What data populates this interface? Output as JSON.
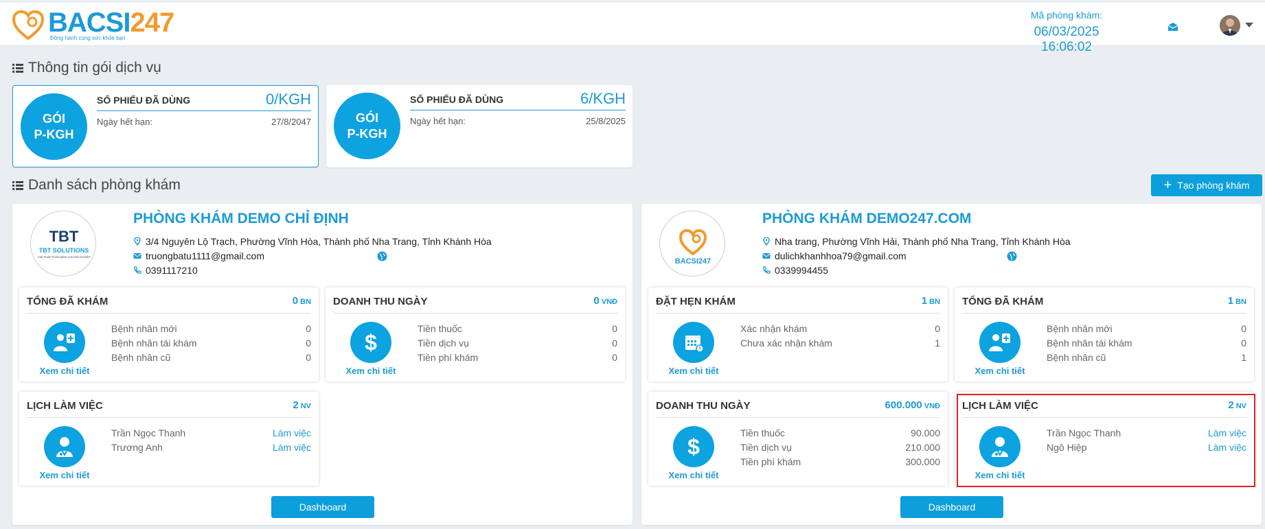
{
  "header": {
    "logo_text": "BACSI247",
    "logo_tagline": "Đồng hành cùng sức khỏe bạn",
    "clinic_code_label": "Mã phòng khám:",
    "datetime": "06/03/2025 16:06:02",
    "icons": [
      "heart-logo-icon",
      "mail-icon",
      "user-avatar",
      "caret-down-icon"
    ]
  },
  "service_section": {
    "title": "Thông tin gói dịch vụ",
    "packages": [
      {
        "circle_line1": "GÓI",
        "circle_line2": "P-KGH",
        "used_label": "SỐ PHIẾU ĐÃ DÙNG",
        "used_value": "0/KGH",
        "expiry_label": "Ngày hết hạn:",
        "expiry_date": "27/8/2047",
        "selected": true
      },
      {
        "circle_line1": "GÓI",
        "circle_line2": "P-KGH",
        "used_label": "SỐ PHIẾU ĐÃ DÙNG",
        "used_value": "6/KGH",
        "expiry_label": "Ngày hết hạn:",
        "expiry_date": "25/8/2025",
        "selected": false
      }
    ]
  },
  "clinic_section": {
    "title": "Danh sách phòng khám",
    "create_button": "Tạo phòng khám"
  },
  "clinics": [
    {
      "name": "PHÒNG KHÁM DEMO CHỈ ĐỊNH",
      "logo_text": "TBT SOLUTIONS",
      "logo_subtext": "GIẢI PHÁP PHẦN MỀM CHUYÊN NGHIỆP",
      "address": "3/4 Nguyên Lộ Trạch, Phường Vĩnh Hòa, Thành phố Nha Trang, Tỉnh Khánh Hòa",
      "email": "truongbatu1111@gmail.com",
      "phone": "0391117210",
      "dashboard_button": "Dashboard",
      "cards": [
        {
          "title": "TỔNG ĐÃ KHÁM",
          "value": "0",
          "unit": "BN",
          "link": "Xem chi tiết",
          "icon": "doctor-patient-icon",
          "rows": [
            {
              "label": "Bệnh nhân mới",
              "value": "0"
            },
            {
              "label": "Bệnh nhân tái khám",
              "value": "0"
            },
            {
              "label": "Bệnh nhân cũ",
              "value": "0"
            }
          ]
        },
        {
          "title": "DOANH THU NGÀY",
          "value": "0",
          "unit": "VNĐ",
          "link": "Xem chi tiết",
          "icon": "dollar-icon",
          "rows": [
            {
              "label": "Tiền thuốc",
              "value": "0"
            },
            {
              "label": "Tiền dịch vụ",
              "value": "0"
            },
            {
              "label": "Tiền phí khám",
              "value": "0"
            }
          ]
        },
        {
          "title": "LỊCH LÀM VIỆC",
          "value": "2",
          "unit": "NV",
          "link": "Xem chi tiết",
          "icon": "doctor-icon",
          "rows": [
            {
              "label": "Trần Ngọc Thanh",
              "value": "Làm việc"
            },
            {
              "label": "Trương Anh",
              "value": "Làm việc"
            }
          ]
        }
      ]
    },
    {
      "name": "PHÒNG KHÁM DEMO247.COM",
      "logo_text": "BACSI247",
      "logo_subtext": "",
      "address": "Nha trang, Phường Vĩnh Hải, Thành phố Nha Trang, Tỉnh Khánh Hòa",
      "email": "dulichkhanhhoa79@gmail.com",
      "phone": "0339994455",
      "dashboard_button": "Dashboard",
      "cards": [
        {
          "title": "ĐẶT HẸN KHÁM",
          "value": "1",
          "unit": "BN",
          "link": "Xem chi tiết",
          "icon": "calendar-icon",
          "rows": [
            {
              "label": "Xác nhận khám",
              "value": "0"
            },
            {
              "label": "Chưa xác nhận khám",
              "value": "1"
            }
          ]
        },
        {
          "title": "TỔNG ĐÃ KHÁM",
          "value": "1",
          "unit": "BN",
          "link": "Xem chi tiết",
          "icon": "doctor-patient-icon",
          "rows": [
            {
              "label": "Bệnh nhân mới",
              "value": "0"
            },
            {
              "label": "Bệnh nhân tái khám",
              "value": "0"
            },
            {
              "label": "Bệnh nhân cũ",
              "value": "1"
            }
          ]
        },
        {
          "title": "DOANH THU NGÀY",
          "value": "600.000",
          "unit": "VNĐ",
          "link": "Xem chi tiết",
          "icon": "dollar-icon",
          "rows": [
            {
              "label": "Tiền thuốc",
              "value": "90.000"
            },
            {
              "label": "Tiền dịch vụ",
              "value": "210.000"
            },
            {
              "label": "Tiền phí khám",
              "value": "300.000"
            }
          ]
        },
        {
          "title": "LỊCH LÀM VIỆC",
          "value": "2",
          "unit": "NV",
          "link": "Xem chi tiết",
          "icon": "doctor-icon",
          "highlighted": true,
          "rows": [
            {
              "label": "Trần Ngọc Thanh",
              "value": "Làm việc"
            },
            {
              "label": "Ngô Hiệp",
              "value": "Làm việc"
            }
          ]
        }
      ]
    }
  ],
  "colors": {
    "accent": "#1d9ad6",
    "button": "#0d9fdc",
    "highlight_border": "#e02020",
    "background": "#ebeef1"
  }
}
